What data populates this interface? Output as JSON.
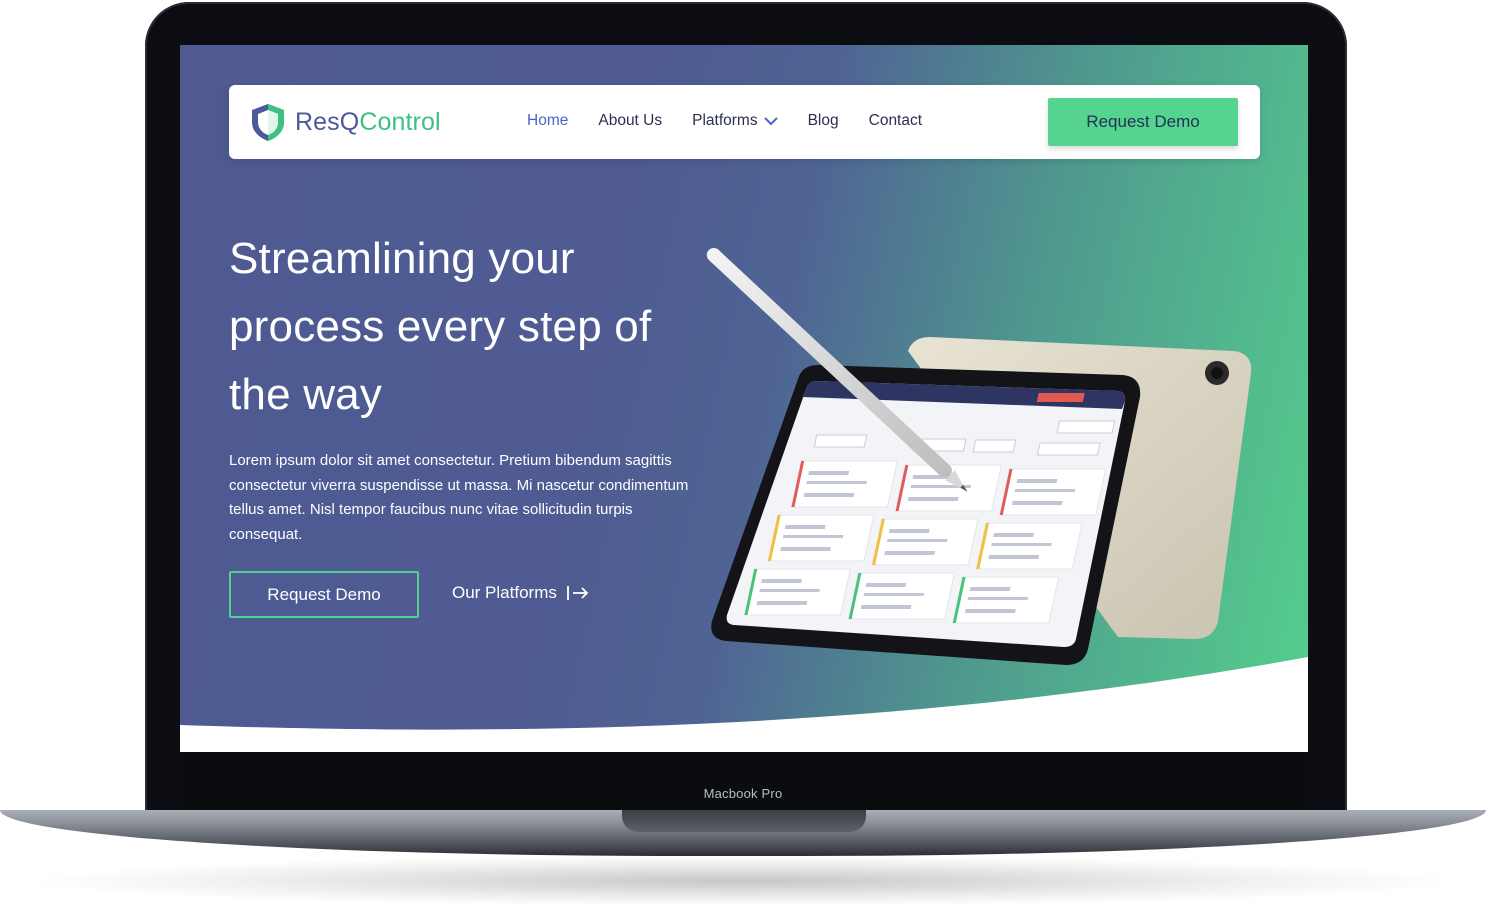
{
  "device": {
    "model_label": "Macbook Pro"
  },
  "nav": {
    "brand_part1": "ResQ",
    "brand_part2": "Control",
    "links": [
      "Home",
      "About Us",
      "Platforms",
      "Blog",
      "Contact"
    ],
    "cta": "Request Demo"
  },
  "hero": {
    "title_line1": "Streamlining your",
    "title_line2": "process every step of",
    "title_line3": "the way",
    "description": "Lorem ipsum dolor sit amet consectetur. Pretium bibendum sagittis consectetur viverra suspendisse ut massa. Mi nascetur condimentum tellus amet. Nisl tempor faucibus nunc vitae sollicitudin turpis consequat.",
    "primary_button": "Request Demo",
    "secondary_link": "Our Platforms"
  },
  "colors": {
    "brand_blue": "#4c5a9a",
    "brand_green": "#55d48f",
    "nav_active": "#4d63c9"
  }
}
